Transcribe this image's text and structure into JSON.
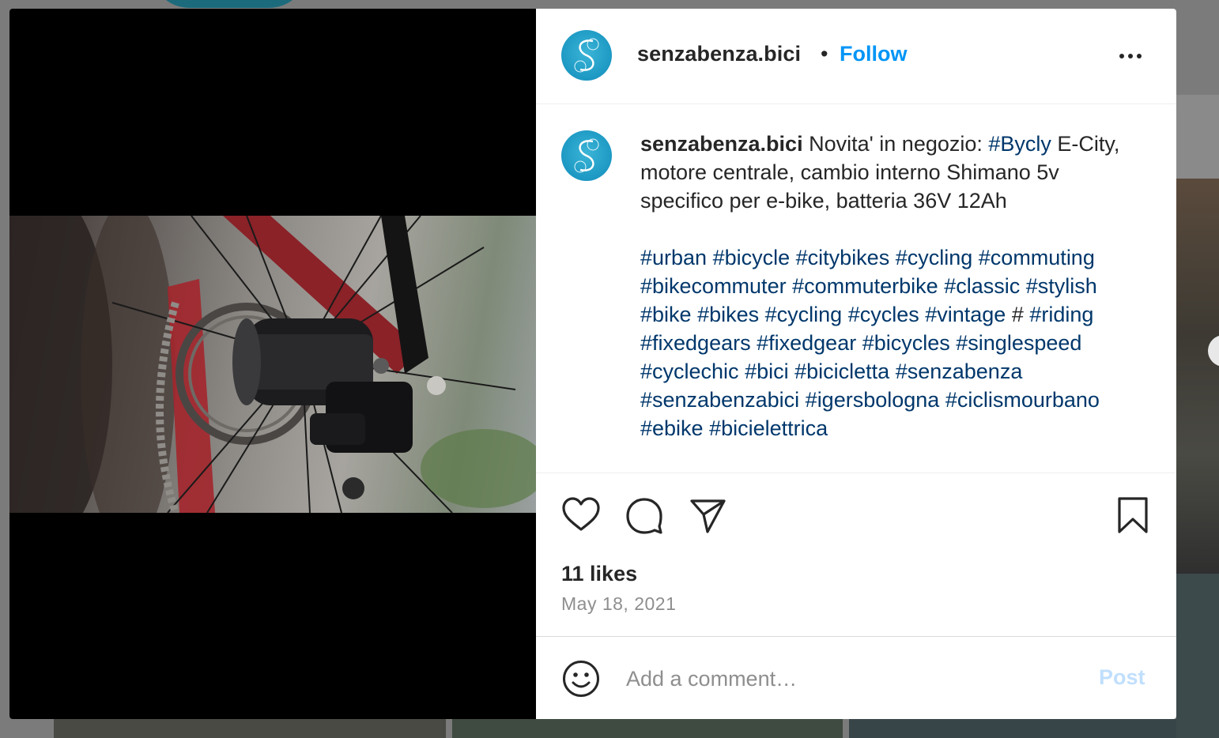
{
  "post": {
    "username": "senzabenza.bici",
    "separator": "•",
    "follow_label": "Follow",
    "caption": {
      "username": "senzabenza.bici",
      "text_before": "Novita' in negozio: ",
      "first_tag": "#Bycly",
      "text_after": " E-City, motore centrale, cambio interno Shimano 5v specifico per e-bike, batteria 36V 12Ah",
      "hashtags_line1": [
        "#urban",
        "#bicycle",
        "#citybikes",
        "#cycling",
        "#commuting",
        "#bikecommuter",
        "#commuterbike",
        "#classic",
        "#stylish",
        "#bike",
        "#bikes",
        "#cycling",
        "#cycles",
        "#vintage"
      ],
      "lone_hash": "#",
      "hashtags_line2": [
        "#riding",
        "#fixedgears",
        "#fixedgear",
        "#bicycles",
        "#singlespeed",
        "#cyclechic",
        "#bici",
        "#bicicletta",
        "#senzabenza",
        "#senzabenzabici",
        "#igersbologna",
        "#ciclismourbano",
        "#ebike",
        "#bicielettrica"
      ]
    },
    "likes_text": "11 likes",
    "date": "May 18, 2021",
    "comment": {
      "placeholder": "Add a comment…",
      "value": "",
      "post_label": "Post"
    },
    "icons": {
      "like": "heart-icon",
      "comment": "comment-icon",
      "share": "send-icon",
      "save": "bookmark-icon",
      "emoji": "emoji-icon",
      "more": "more-options-icon"
    }
  },
  "colors": {
    "accent": "#0095f6",
    "hashtag": "#00376b",
    "text": "#262626",
    "muted": "#8e8e8e",
    "post_disabled": "#c0dffd",
    "avatar": "#1c98c3"
  }
}
